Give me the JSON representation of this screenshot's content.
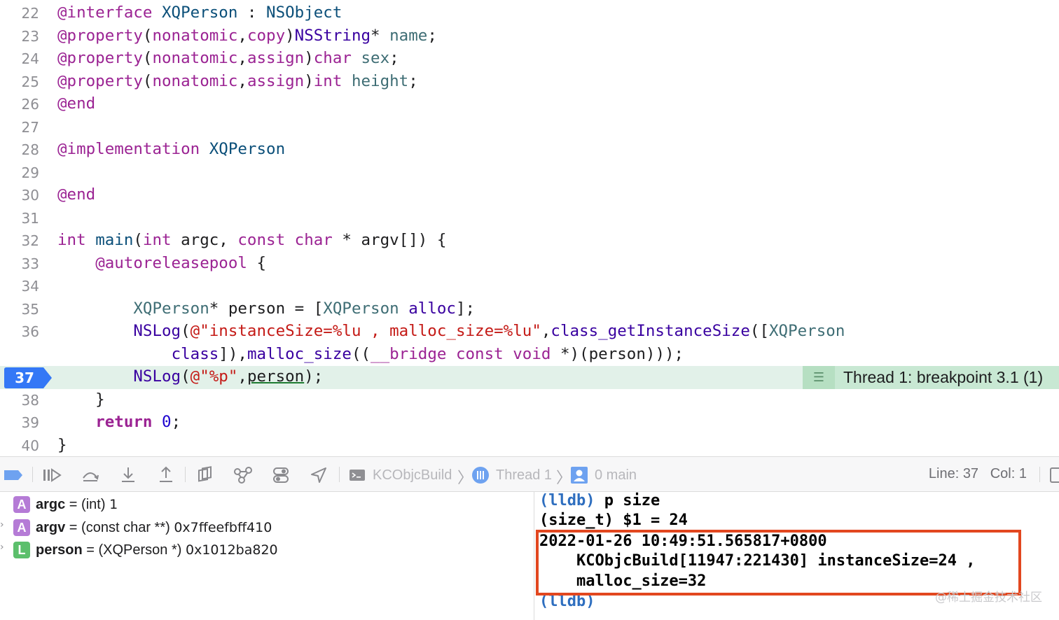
{
  "editor": {
    "lines": [
      {
        "num": "22",
        "tokens": [
          [
            "kw",
            "@interface"
          ],
          [
            "pl",
            " "
          ],
          [
            "ty",
            "XQPerson"
          ],
          [
            "pl",
            " : "
          ],
          [
            "ty",
            "NSObject"
          ]
        ]
      },
      {
        "num": "23",
        "tokens": [
          [
            "kw",
            "@property"
          ],
          [
            "pl",
            "("
          ],
          [
            "kw",
            "nonatomic"
          ],
          [
            "pl",
            ","
          ],
          [
            "kw",
            "copy"
          ],
          [
            "pl",
            ")"
          ],
          [
            "fn",
            "NSString"
          ],
          [
            "pl",
            "* "
          ],
          [
            "pr",
            "name"
          ],
          [
            "pl",
            ";"
          ]
        ]
      },
      {
        "num": "24",
        "tokens": [
          [
            "kw",
            "@property"
          ],
          [
            "pl",
            "("
          ],
          [
            "kw",
            "nonatomic"
          ],
          [
            "pl",
            ","
          ],
          [
            "kw",
            "assign"
          ],
          [
            "pl",
            ")"
          ],
          [
            "kw",
            "char"
          ],
          [
            "pl",
            " "
          ],
          [
            "pr",
            "sex"
          ],
          [
            "pl",
            ";"
          ]
        ]
      },
      {
        "num": "25",
        "tokens": [
          [
            "kw",
            "@property"
          ],
          [
            "pl",
            "("
          ],
          [
            "kw",
            "nonatomic"
          ],
          [
            "pl",
            ","
          ],
          [
            "kw",
            "assign"
          ],
          [
            "pl",
            ")"
          ],
          [
            "kw",
            "int"
          ],
          [
            "pl",
            " "
          ],
          [
            "pr",
            "height"
          ],
          [
            "pl",
            ";"
          ]
        ]
      },
      {
        "num": "26",
        "tokens": [
          [
            "kw",
            "@end"
          ]
        ]
      },
      {
        "num": "27",
        "tokens": []
      },
      {
        "num": "28",
        "tokens": [
          [
            "kw",
            "@implementation"
          ],
          [
            "pl",
            " "
          ],
          [
            "ty",
            "XQPerson"
          ]
        ]
      },
      {
        "num": "29",
        "tokens": []
      },
      {
        "num": "30",
        "tokens": [
          [
            "kw",
            "@end"
          ]
        ]
      },
      {
        "num": "31",
        "tokens": []
      },
      {
        "num": "32",
        "tokens": [
          [
            "kw",
            "int"
          ],
          [
            "pl",
            " "
          ],
          [
            "ty",
            "main"
          ],
          [
            "pl",
            "("
          ],
          [
            "kw",
            "int"
          ],
          [
            "pl",
            " argc, "
          ],
          [
            "kw",
            "const"
          ],
          [
            "pl",
            " "
          ],
          [
            "kw",
            "char"
          ],
          [
            "pl",
            " * argv[]) {"
          ]
        ]
      },
      {
        "num": "33",
        "tokens": [
          [
            "pl",
            "    "
          ],
          [
            "kw",
            "@autoreleasepool"
          ],
          [
            "pl",
            " {"
          ]
        ]
      },
      {
        "num": "34",
        "tokens": []
      },
      {
        "num": "35",
        "tokens": [
          [
            "pl",
            "        "
          ],
          [
            "pr",
            "XQPerson"
          ],
          [
            "pl",
            "* person = ["
          ],
          [
            "pr",
            "XQPerson"
          ],
          [
            "pl",
            " "
          ],
          [
            "fn",
            "alloc"
          ],
          [
            "pl",
            "];"
          ]
        ]
      },
      {
        "num": "36",
        "tokens": [
          [
            "pl",
            "        "
          ],
          [
            "fn",
            "NSLog"
          ],
          [
            "pl",
            "("
          ],
          [
            "st",
            "@\"instanceSize=%lu , malloc_size=%lu\""
          ],
          [
            "pl",
            ","
          ],
          [
            "fn",
            "class_getInstanceSize"
          ],
          [
            "pl",
            "(["
          ],
          [
            "pr",
            "XQPerson"
          ]
        ]
      },
      {
        "num": "",
        "tokens": [
          [
            "pl",
            "            "
          ],
          [
            "fn",
            "class"
          ],
          [
            "pl",
            "]),"
          ],
          [
            "fn",
            "malloc_size"
          ],
          [
            "pl",
            "(("
          ],
          [
            "kw",
            "__bridge"
          ],
          [
            "pl",
            " "
          ],
          [
            "kw",
            "const"
          ],
          [
            "pl",
            " "
          ],
          [
            "kw",
            "void"
          ],
          [
            "pl",
            " *)(person)));"
          ]
        ]
      },
      {
        "num": "37",
        "tokens": [
          [
            "pl",
            "        "
          ],
          [
            "fn",
            "NSLog"
          ],
          [
            "pl",
            "("
          ],
          [
            "st",
            "@\"%p\""
          ],
          [
            "pl",
            ","
          ],
          [
            "ul",
            "person"
          ],
          [
            "pl",
            ");"
          ]
        ]
      },
      {
        "num": "38",
        "tokens": [
          [
            "pl",
            "    }"
          ]
        ]
      },
      {
        "num": "39",
        "tokens": [
          [
            "pl",
            "    "
          ],
          [
            "kwb",
            "return"
          ],
          [
            "pl",
            " "
          ],
          [
            "nu",
            "0"
          ],
          [
            "pl",
            ";"
          ]
        ]
      },
      {
        "num": "40",
        "tokens": [
          [
            "pl",
            "}"
          ]
        ]
      }
    ],
    "current_line": "37",
    "breakpoint_annotation": "Thread 1: breakpoint 3.1 (1)"
  },
  "debug_bar": {
    "breadcrumb": {
      "target": "KCObjcBuild",
      "thread": "Thread 1",
      "frame": "0 main"
    },
    "position": {
      "line_label": "Line:",
      "line": "37",
      "col_label": "Col:",
      "col": "1"
    }
  },
  "variables": [
    {
      "badge": "A",
      "kind": "arg",
      "name": "argc",
      "eq": " = ",
      "type": "(int)",
      "value": "1",
      "expandable": false
    },
    {
      "badge": "A",
      "kind": "arg",
      "name": "argv",
      "eq": " = ",
      "type": "(const char **)",
      "value": "0x7ffeefbff410",
      "expandable": true
    },
    {
      "badge": "L",
      "kind": "loc",
      "name": "person",
      "eq": " = ",
      "type": "(XQPerson *)",
      "value": "0x1012ba820",
      "expandable": true
    }
  ],
  "console": {
    "prompt": "(lldb)",
    "command": " p size",
    "result": "(size_t) $1 = 24",
    "output_line1": "2022-01-26 10:49:51.565817+0800",
    "output_line2": "    KCObjcBuild[11947:221430] instanceSize=24 ,",
    "output_line3": "    malloc_size=32",
    "prompt2": "(lldb)"
  },
  "watermark": "@稀土掘金技术社区",
  "colors": {
    "current_line_bg": "#e2f1e9",
    "pc_flag": "#3478f6",
    "highlight_box": "#e2471f",
    "prompt": "#2e6ebf"
  },
  "icons": [
    "breakpoints-toggle-icon",
    "continue-icon",
    "step-over-icon",
    "step-into-icon",
    "step-out-icon",
    "view-hierarchy-icon",
    "memory-graph-icon",
    "environment-overrides-icon",
    "simulate-location-icon",
    "terminal-icon",
    "thread-icon",
    "frame-icon"
  ]
}
